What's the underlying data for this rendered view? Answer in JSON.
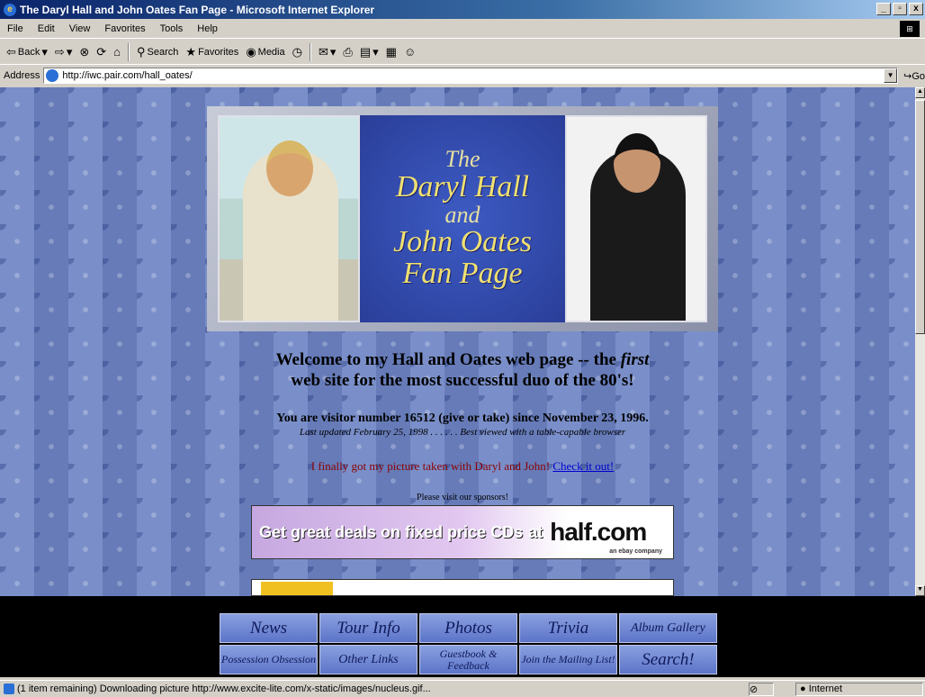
{
  "window": {
    "title": "The Daryl Hall and John Oates Fan Page - Microsoft Internet Explorer",
    "controls": [
      "_",
      "\u0001",
      "x"
    ]
  },
  "menu": [
    "File",
    "Edit",
    "View",
    "Favorites",
    "Tools",
    "Help"
  ],
  "toolbar": {
    "back": "Back",
    "search": "Search",
    "favorites": "Favorites",
    "media": "Media"
  },
  "address": {
    "label": "Address",
    "url": "http://iwc.pair.com/hall_oates/",
    "go": "Go"
  },
  "banner": {
    "line1": "The",
    "line2": "Daryl Hall",
    "line3": "and",
    "line4": "John Oates",
    "line5": "Fan Page"
  },
  "page": {
    "welcome_a": "Welcome to my Hall and Oates web page -- the ",
    "welcome_em": "first",
    "welcome_b": "web site for the most successful duo of the 80's!",
    "visitor": "You are visitor number 16512 (give or take) since November 23, 1996.",
    "updated": "Last updated February 25, 1998 . . . . . . Best viewed with a table-capable browser",
    "picture_text": "I finally got my picture taken with Daryl and John! ",
    "picture_link": "Check it out!",
    "sponsors": "Please visit our sponsors!"
  },
  "ad": {
    "text": "Get great deals on fixed price CDs",
    "at": "at",
    "brand": "half.com",
    "ebay": "an ebay company"
  },
  "nav": [
    {
      "label": "News"
    },
    {
      "label": "Tour Info"
    },
    {
      "label": "Photos"
    },
    {
      "label": "Trivia"
    },
    {
      "label": "Album Gallery"
    },
    {
      "label": "Possession Obsession"
    },
    {
      "label": "Other Links"
    },
    {
      "label": "Guestbook & Feedback"
    },
    {
      "label": "Join the Mailing List!"
    },
    {
      "label": "Search!"
    }
  ],
  "status": {
    "text": "(1 item remaining) Downloading picture http://www.excite-lite.com/x-static/images/nucleus.gif...",
    "zone": "Internet"
  }
}
